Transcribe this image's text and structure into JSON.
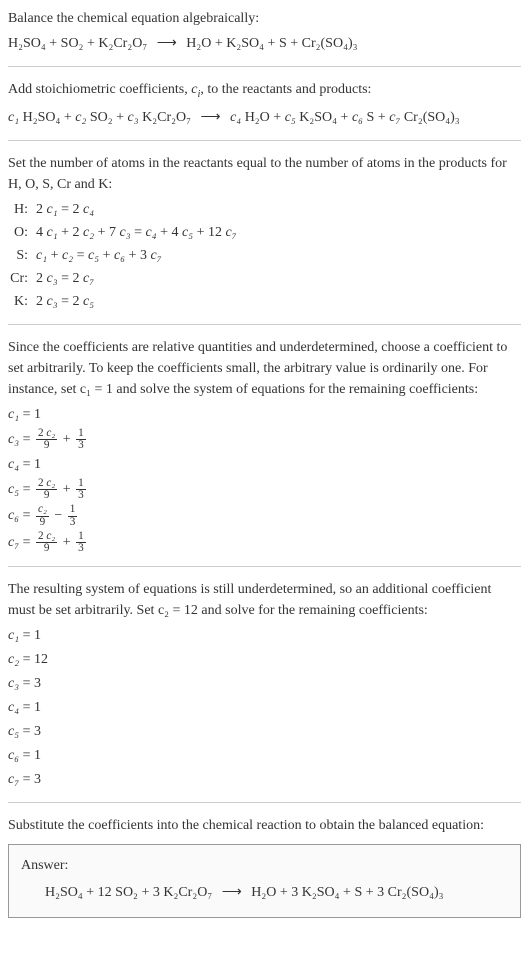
{
  "intro": {
    "line1": "Balance the chemical equation algebraically:",
    "eq1_lhs": "H₂SO₄ + SO₂ + K₂Cr₂O₇",
    "eq1_arrow": "⟶",
    "eq1_rhs": "H₂O + K₂SO₄ + S + Cr₂(SO₄)₃"
  },
  "step2": {
    "line1_a": "Add stoichiometric coefficients, ",
    "line1_ci": "c",
    "line1_ci_sub": "i",
    "line1_b": ", to the reactants and products:",
    "eq_c1": "c₁",
    "eq_h2so4": " H₂SO₄ + ",
    "eq_c2": "c₂",
    "eq_so2": " SO₂ + ",
    "eq_c3": "c₃",
    "eq_k2cr2o7": " K₂Cr₂O₇",
    "eq_arrow": "⟶",
    "eq_c4": "c₄",
    "eq_h2o": " H₂O + ",
    "eq_c5": "c₅",
    "eq_k2so4": " K₂SO₄ + ",
    "eq_c6": "c₆",
    "eq_s": " S + ",
    "eq_c7": "c₇",
    "eq_cr2so43": " Cr₂(SO₄)₃"
  },
  "step3": {
    "line1": "Set the number of atoms in the reactants equal to the number of atoms in the products for H, O, S, Cr and K:",
    "atoms": [
      {
        "label": "H:",
        "eq": "2 c₁ = 2 c₄"
      },
      {
        "label": "O:",
        "eq": "4 c₁ + 2 c₂ + 7 c₃ = c₄ + 4 c₅ + 12 c₇"
      },
      {
        "label": "S:",
        "eq": "c₁ + c₂ = c₅ + c₆ + 3 c₇"
      },
      {
        "label": "Cr:",
        "eq": "2 c₃ = 2 c₇"
      },
      {
        "label": "K:",
        "eq": "2 c₃ = 2 c₅"
      }
    ]
  },
  "step4": {
    "para": "Since the coefficients are relative quantities and underdetermined, choose a coefficient to set arbitrarily. To keep the coefficients small, the arbitrary value is ordinarily one. For instance, set c₁ = 1 and solve the system of equations for the remaining coefficients:",
    "rows": [
      {
        "lhs": "c₁",
        "type": "plain",
        "val": "1"
      },
      {
        "lhs": "c₃",
        "type": "fracplus",
        "num": "2 c₂",
        "den": "9",
        "op": " + ",
        "num2": "1",
        "den2": "3"
      },
      {
        "lhs": "c₄",
        "type": "plain",
        "val": "1"
      },
      {
        "lhs": "c₅",
        "type": "fracplus",
        "num": "2 c₂",
        "den": "9",
        "op": " + ",
        "num2": "1",
        "den2": "3"
      },
      {
        "lhs": "c₆",
        "type": "fracplus",
        "num": "c₂",
        "den": "9",
        "op": " − ",
        "num2": "1",
        "den2": "3"
      },
      {
        "lhs": "c₇",
        "type": "fracplus",
        "num": "2 c₂",
        "den": "9",
        "op": " + ",
        "num2": "1",
        "den2": "3"
      }
    ]
  },
  "step5": {
    "para": "The resulting system of equations is still underdetermined, so an additional coefficient must be set arbitrarily. Set c₂ = 12 and solve for the remaining coefficients:",
    "rows": [
      {
        "lhs": "c₁",
        "val": "1"
      },
      {
        "lhs": "c₂",
        "val": "12"
      },
      {
        "lhs": "c₃",
        "val": "3"
      },
      {
        "lhs": "c₄",
        "val": "1"
      },
      {
        "lhs": "c₅",
        "val": "3"
      },
      {
        "lhs": "c₆",
        "val": "1"
      },
      {
        "lhs": "c₇",
        "val": "3"
      }
    ]
  },
  "step6": {
    "para": "Substitute the coefficients into the chemical reaction to obtain the balanced equation:"
  },
  "answer": {
    "label": "Answer:",
    "eq_lhs": "H₂SO₄ + 12 SO₂ + 3 K₂Cr₂O₇",
    "eq_arrow": "⟶",
    "eq_rhs": "H₂O + 3 K₂SO₄ + S + 3 Cr₂(SO₄)₃"
  }
}
